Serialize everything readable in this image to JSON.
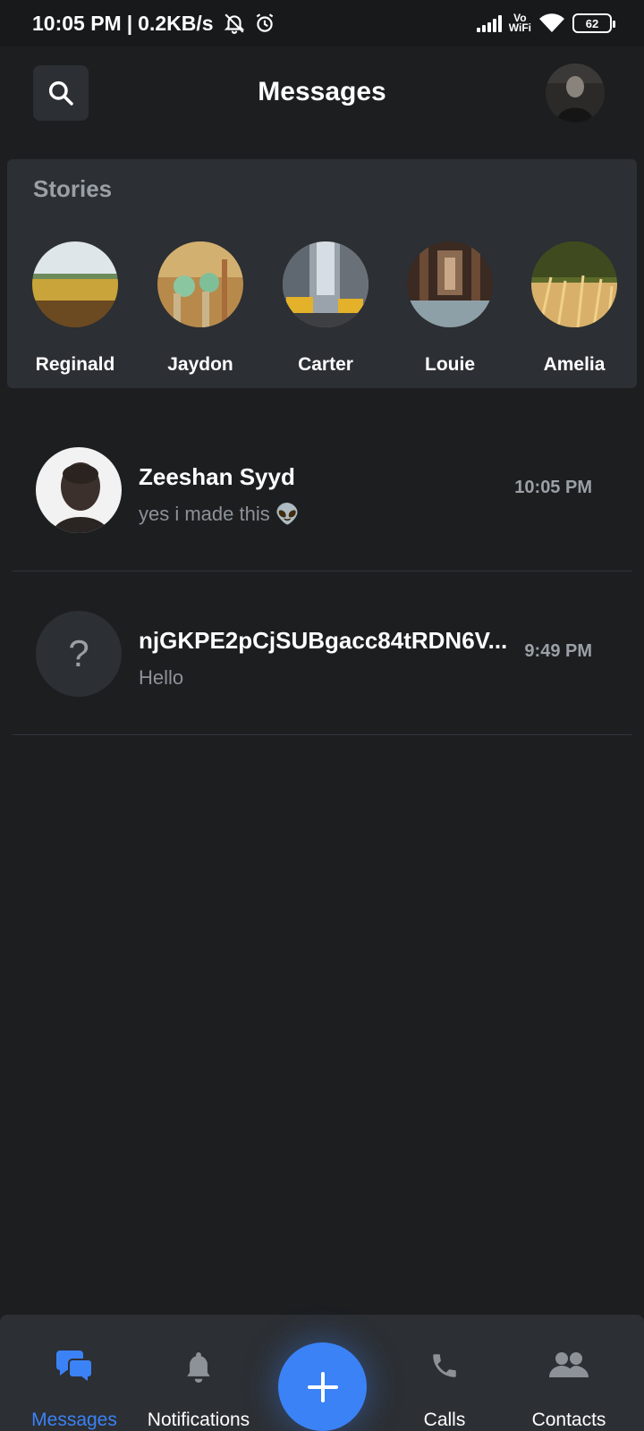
{
  "status_bar": {
    "time": "10:05 PM",
    "separator": "|",
    "speed": "0.2KB/s",
    "vowifi_top": "Vo",
    "vowifi_bottom": "WiFi",
    "battery": "62"
  },
  "header": {
    "title": "Messages",
    "search_icon": "search-icon",
    "profile_avatar": "profile-avatar"
  },
  "stories": {
    "title": "Stories",
    "items": [
      {
        "name": "Reginald"
      },
      {
        "name": "Jaydon"
      },
      {
        "name": "Carter"
      },
      {
        "name": "Louie"
      },
      {
        "name": "Amelia"
      }
    ]
  },
  "chats": [
    {
      "name": "Zeeshan  Syyd",
      "preview": "yes i made this 👽",
      "time": "10:05 PM"
    },
    {
      "name": "njGKPE2pCjSUBgacc84tRDN6V...",
      "preview": "Hello",
      "time": "9:49 PM",
      "avatar_symbol": "?"
    }
  ],
  "bottom_nav": {
    "items": [
      {
        "label": "Messages",
        "icon": "chat-bubbles-icon",
        "active": true
      },
      {
        "label": "Notifications",
        "icon": "bell-icon"
      },
      {
        "label": "Calls",
        "icon": "phone-icon"
      },
      {
        "label": "Contacts",
        "icon": "people-icon"
      }
    ],
    "fab_icon": "plus-icon"
  },
  "colors": {
    "background": "#1c1e20",
    "surface": "#2c2f33",
    "accent": "#3b82f6",
    "muted_text": "#9aa0a6"
  }
}
